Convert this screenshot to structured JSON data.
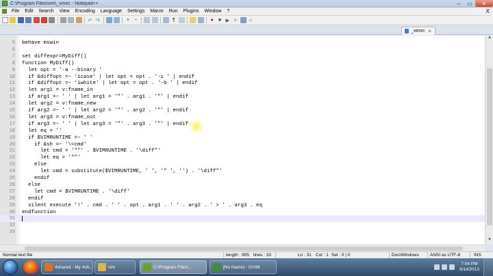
{
  "window": {
    "title": "C:\\Program Files\\vim\\_vimrc - Notepad++",
    "minimize": "–",
    "maximize": "▭",
    "close": "✕"
  },
  "menu": {
    "items": [
      "File",
      "Edit",
      "Search",
      "View",
      "Encoding",
      "Language",
      "Settings",
      "Macro",
      "Run",
      "Plugins",
      "Window",
      "?"
    ],
    "close_doc": "X"
  },
  "toolbar": {
    "buttons": [
      "new-file",
      "open-folder",
      "save",
      "save-all",
      "close",
      "close-all",
      "print",
      "cut",
      "copy",
      "paste",
      "undo",
      "redo",
      "find",
      "replace",
      "zoom-in",
      "zoom-out",
      "sync-vertical",
      "sync-horizontal",
      "word-wrap",
      "show-all",
      "indent-guide",
      "user-lang",
      "doc-map",
      "record",
      "stop",
      "play",
      "play-multiple",
      "save-macro",
      "spell-check"
    ]
  },
  "tabs": [
    {
      "label": "_vimrc",
      "close": "✕"
    }
  ],
  "editor": {
    "lines": [
      {
        "n": "5",
        "text": "behave mswin"
      },
      {
        "n": "6",
        "text": ""
      },
      {
        "n": "7",
        "text": "set diffexpr=MyDiff()"
      },
      {
        "n": "8",
        "text": "function MyDiff()"
      },
      {
        "n": "9",
        "text": "  let opt = '-a --binary '"
      },
      {
        "n": "10",
        "text": "  if &diffopt =~ 'icase' | let opt = opt . '-i ' | endif"
      },
      {
        "n": "11",
        "text": "  if &diffopt =~ 'iwhite' | let opt = opt . '-b ' | endif"
      },
      {
        "n": "12",
        "text": "  let arg1 = v:fname_in"
      },
      {
        "n": "13",
        "text": "  if arg1 =~ ' ' | let arg1 = '\"' . arg1 . '\"' | endif"
      },
      {
        "n": "14",
        "text": "  let arg2 = v:fname_new"
      },
      {
        "n": "15",
        "text": "  if arg2 =~ ' ' | let arg2 = '\"' . arg2 . '\"' | endif"
      },
      {
        "n": "16",
        "text": "  let arg3 = v:fname_out"
      },
      {
        "n": "17",
        "text": "  if arg3 =~ ' ' | let arg3 = '\"' . arg3 . '\"' | endif"
      },
      {
        "n": "18",
        "text": "  let eq = ''"
      },
      {
        "n": "19",
        "text": "  if $VIMRUNTIME =~ ' '"
      },
      {
        "n": "20",
        "text": "    if &sh =~ '\\<cmd'"
      },
      {
        "n": "21",
        "text": "      let cmd = '\"\"' . $VIMRUNTIME . '\\diff\"'"
      },
      {
        "n": "22",
        "text": "      let eq = '\"\"'"
      },
      {
        "n": "23",
        "text": "    else"
      },
      {
        "n": "24",
        "text": "      let cmd = substitute($VIMRUNTIME, ' ', '\" ', '') . '\\diff\"'"
      },
      {
        "n": "25",
        "text": "    endif"
      },
      {
        "n": "26",
        "text": "  else"
      },
      {
        "n": "27",
        "text": "    let cmd = $VIMRUNTIME . '\\diff'"
      },
      {
        "n": "28",
        "text": "  endif"
      },
      {
        "n": "29",
        "text": "  silent execute '!' . cmd . ' ' . opt . arg1 . ' ' . arg2 . ' > ' . arg3 . eq"
      },
      {
        "n": "30",
        "text": "endfunction"
      },
      {
        "n": "31",
        "text": ""
      },
      {
        "n": "32",
        "text": ""
      },
      {
        "n": "33",
        "text": ""
      }
    ],
    "current_line_number": "31"
  },
  "status": {
    "file_type": "Normal text file",
    "length": "length : 905",
    "lines": "lines : 33",
    "position": "Ln : 31",
    "column": "Col : 1",
    "selection": "Sel : 0 | 0",
    "eol": "Dos\\Windows",
    "encoding": "ANSI as UTF-8",
    "mode": "INS"
  },
  "taskbar": {
    "items": [
      {
        "label": "4shared - My 4sh...",
        "active": false,
        "color": "#e07020"
      },
      {
        "label": "vim",
        "active": false,
        "color": "#d9b44a"
      },
      {
        "label": "C:\\Program Files\\...",
        "active": true,
        "color": "#6b9e2f"
      },
      {
        "label": "[No Name] - GVIM",
        "active": false,
        "color": "#3c8f3c"
      }
    ],
    "time": "7:04 PM",
    "date": "8/14/2013"
  },
  "colors": {
    "current_line": "#e8e8ff",
    "gutter": "#e4e4e4",
    "taskbar": "#2f4a68",
    "cursor_highlight": "#fff03c"
  }
}
